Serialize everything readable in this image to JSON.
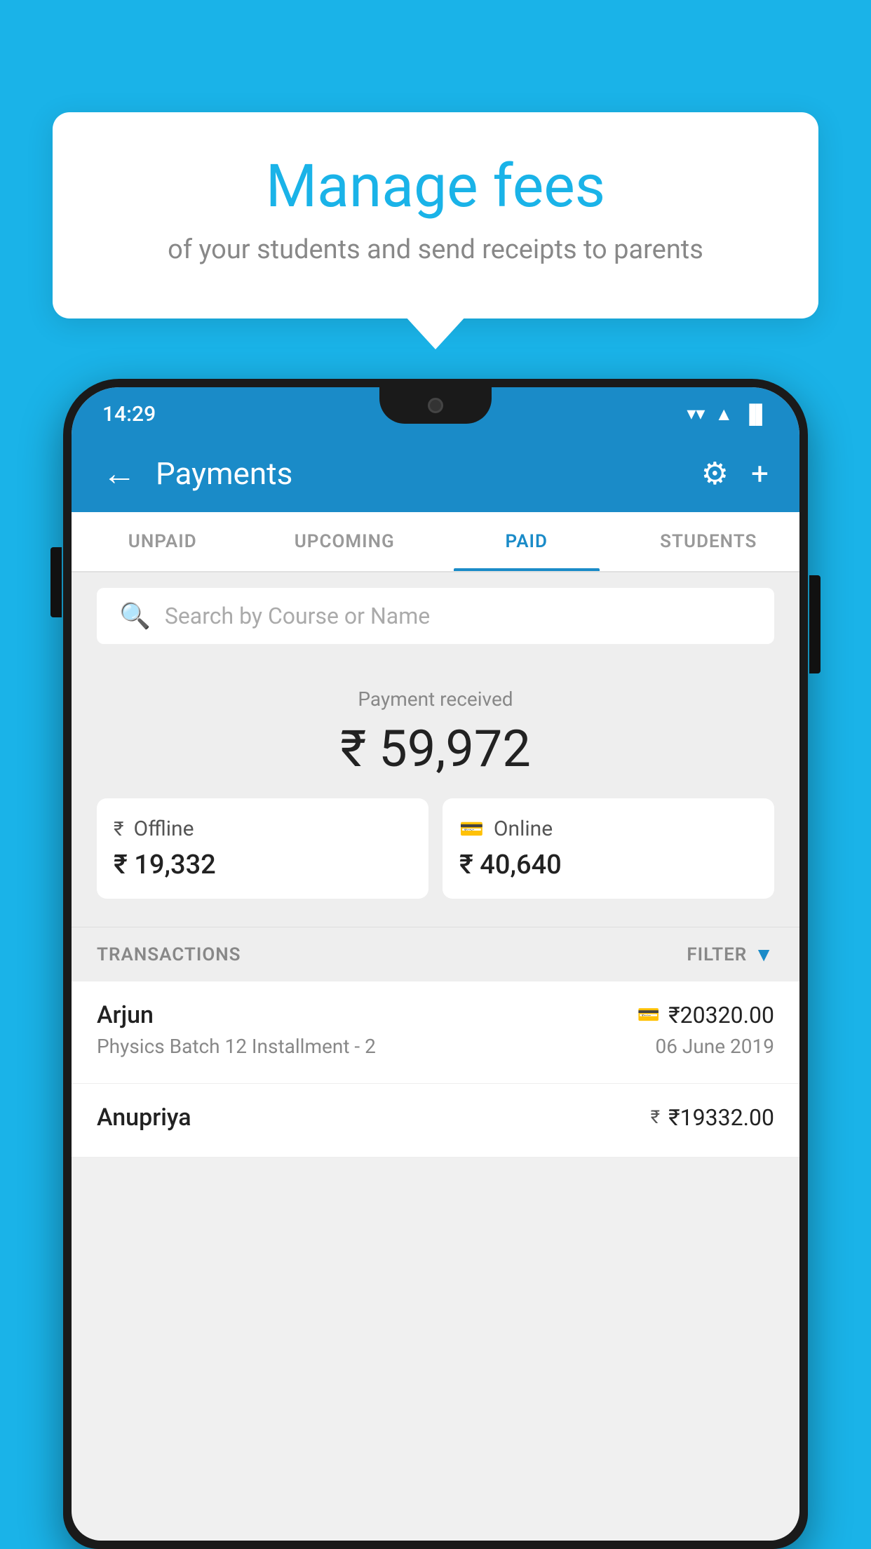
{
  "background_color": "#1ab3e8",
  "tooltip": {
    "title": "Manage fees",
    "subtitle": "of your students and send receipts to parents"
  },
  "status_bar": {
    "time": "14:29",
    "wifi_symbol": "▼",
    "signal_symbol": "▲",
    "battery_symbol": "▐"
  },
  "header": {
    "title": "Payments",
    "back_label": "←",
    "gear_symbol": "⚙",
    "plus_symbol": "+"
  },
  "tabs": [
    {
      "id": "unpaid",
      "label": "UNPAID",
      "active": false
    },
    {
      "id": "upcoming",
      "label": "UPCOMING",
      "active": false
    },
    {
      "id": "paid",
      "label": "PAID",
      "active": true
    },
    {
      "id": "students",
      "label": "STUDENTS",
      "active": false
    }
  ],
  "search": {
    "placeholder": "Search by Course or Name"
  },
  "payment_summary": {
    "received_label": "Payment received",
    "total_amount": "₹ 59,972",
    "offline": {
      "label": "Offline",
      "amount": "₹ 19,332"
    },
    "online": {
      "label": "Online",
      "amount": "₹ 40,640"
    }
  },
  "transactions": {
    "label": "TRANSACTIONS",
    "filter_label": "FILTER",
    "items": [
      {
        "name": "Arjun",
        "course": "Physics Batch 12 Installment - 2",
        "amount": "₹20320.00",
        "date": "06 June 2019",
        "pay_type": "card"
      },
      {
        "name": "Anupriya",
        "course": "",
        "amount": "₹19332.00",
        "date": "",
        "pay_type": "offline"
      }
    ]
  }
}
